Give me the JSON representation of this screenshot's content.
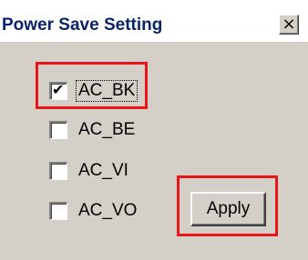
{
  "window": {
    "title": "Power Save Setting",
    "close_glyph": "×"
  },
  "options": [
    {
      "label": "AC_BK",
      "checked": true
    },
    {
      "label": "AC_BE",
      "checked": false
    },
    {
      "label": "AC_VI",
      "checked": false
    },
    {
      "label": "AC_VO",
      "checked": false
    }
  ],
  "check_glyph": "✔",
  "apply_label": "Apply",
  "annotation": {
    "highlight_color": "#e8151b"
  },
  "colors": {
    "title_text": "#0a246a",
    "dialog_face": "#d4d0c8"
  }
}
